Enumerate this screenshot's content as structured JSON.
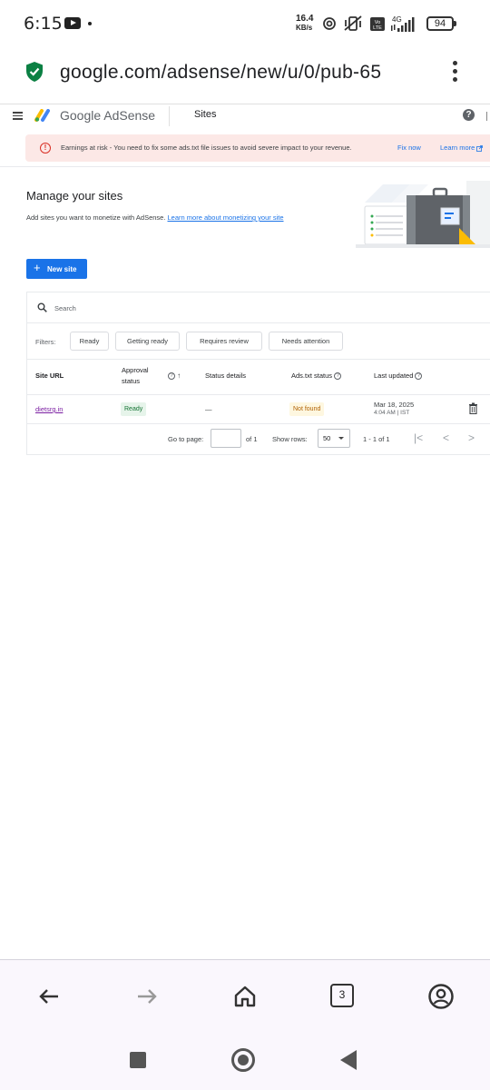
{
  "status_bar": {
    "time": "6:15",
    "net_speed_value": "16.4",
    "net_speed_unit": "KB/s",
    "network": "4G",
    "volte": "Vo LTE",
    "battery": "94"
  },
  "browser": {
    "url": "google.com/adsense/new/u/0/pub-65",
    "tab_count": "3"
  },
  "header": {
    "brand": "Google AdSense",
    "section": "Sites",
    "help": "?"
  },
  "alert": {
    "message": "Earnings at risk - You need to fix some ads.txt file issues to avoid severe impact to your revenue.",
    "fix_label": "Fix now",
    "learn_label": "Learn more"
  },
  "manage": {
    "title": "Manage your sites",
    "description": "Add sites you want to monetize with AdSense.",
    "link": "Learn more about monetizing your site",
    "new_site_label": "New site"
  },
  "table": {
    "search_placeholder": "Search",
    "filters_label": "Filters:",
    "filters": [
      "Ready",
      "Getting ready",
      "Requires review",
      "Needs attention"
    ],
    "columns": {
      "site_url": "Site URL",
      "approval_status_1": "Approval",
      "approval_status_2": "status",
      "status_details": "Status details",
      "ads_txt_status": "Ads.txt status",
      "last_updated": "Last updated"
    },
    "rows": [
      {
        "site_url": "dietsrg.in",
        "approval_status": "Ready",
        "status_details": "—",
        "ads_txt_status": "Not found",
        "last_updated_date": "Mar 18, 2025",
        "last_updated_time": "4:04 AM | IST"
      }
    ],
    "pagination": {
      "go_to_page_label": "Go to page:",
      "of_label": "of 1",
      "show_rows_label": "Show rows:",
      "rows_value": "50",
      "range": "1 - 1 of 1"
    }
  },
  "colors": {
    "primary": "#1a73e8",
    "alert_bg": "#fce8e6",
    "alert_icon": "#d93025",
    "ready_bg": "#e6f4ea",
    "ready_text": "#137333",
    "not_found_bg": "#fef7e0",
    "not_found_text": "#b06000",
    "link_visited": "#7b1fa2"
  }
}
